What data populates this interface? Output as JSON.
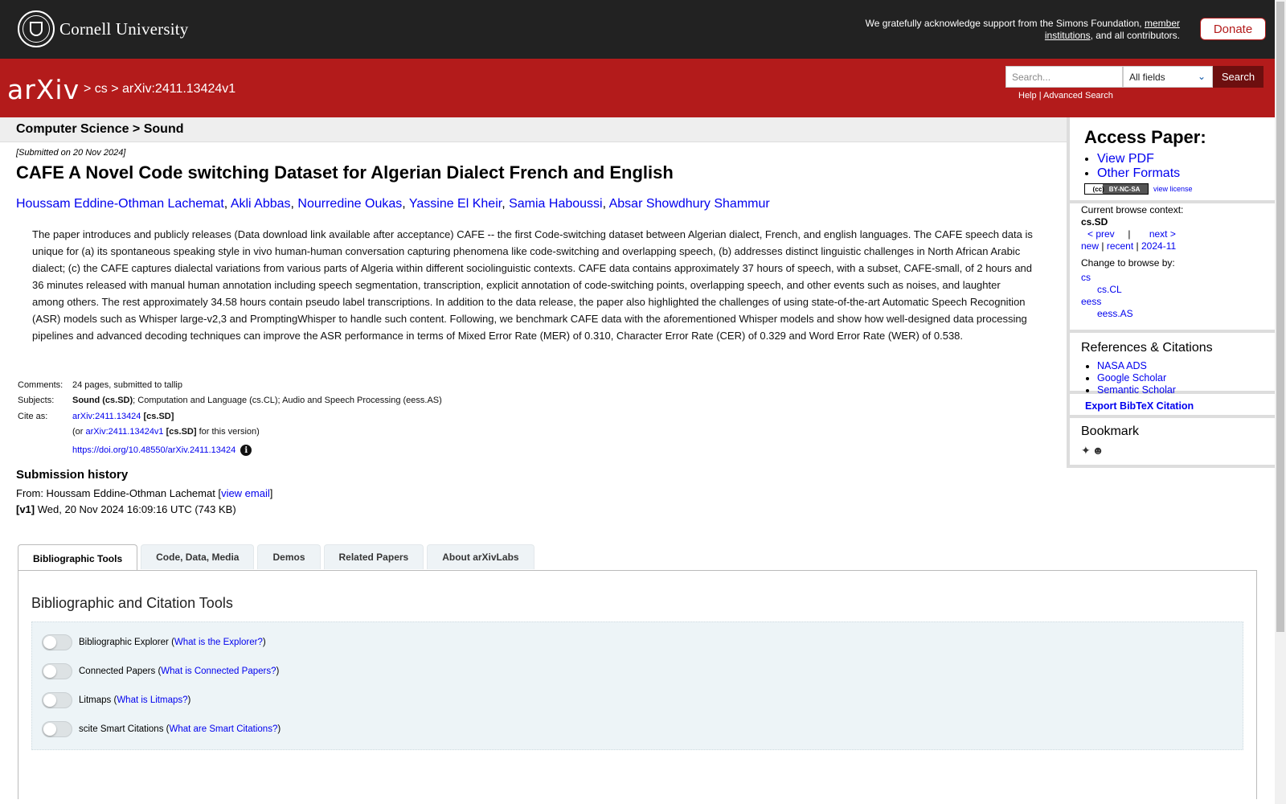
{
  "cornell": {
    "name": "Cornell University",
    "support_text": "We gratefully acknowledge support from the Simons Foundation,",
    "member_link": "member institutions",
    "support_tail": ", and all contributors.",
    "donate_label": "Donate"
  },
  "header": {
    "logo_text": "arXiv",
    "crumb_cs": "> cs >",
    "crumb_id": "arXiv:2411.13424v1",
    "search_placeholder": "Search...",
    "field_value": "All fields",
    "search_label": "Search",
    "help_label": "Help",
    "separator": "|",
    "advanced_label": "Advanced Search"
  },
  "subject_header": "Computer Science > Sound",
  "submitted": "[Submitted on 20 Nov 2024]",
  "title": "CAFE A Novel Code switching Dataset for Algerian Dialect French and English",
  "authors": [
    "Houssam Eddine-Othman Lachemat",
    "Akli Abbas",
    "Nourredine Oukas",
    "Yassine El Kheir",
    "Samia Haboussi",
    "Absar Showdhury Shammur"
  ],
  "abstract": "The paper introduces and publicly releases (Data download link available after acceptance) CAFE -- the first Code-switching dataset between Algerian dialect, French, and english languages. The CAFE speech data is unique for (a) its spontaneous speaking style in vivo human-human conversation capturing phenomena like code-switching and overlapping speech, (b) addresses distinct linguistic challenges in North African Arabic dialect; (c) the CAFE captures dialectal variations from various parts of Algeria within different sociolinguistic contexts. CAFE data contains approximately 37 hours of speech, with a subset, CAFE-small, of 2 hours and 36 minutes released with manual human annotation including speech segmentation, transcription, explicit annotation of code-switching points, overlapping speech, and other events such as noises, and laughter among others. The rest approximately 34.58 hours contain pseudo label transcriptions. In addition to the data release, the paper also highlighted the challenges of using state-of-the-art Automatic Speech Recognition (ASR) models such as Whisper large-v2,3 and PromptingWhisper to handle such content. Following, we benchmark CAFE data with the aforementioned Whisper models and show how well-designed data processing pipelines and advanced decoding techniques can improve the ASR performance in terms of Mixed Error Rate (MER) of 0.310, Character Error Rate (CER) of 0.329 and Word Error Rate (WER) of 0.538.",
  "meta": {
    "comments_label": "Comments:",
    "comments": "24 pages, submitted to tallip",
    "subjects_label": "Subjects:",
    "subjects_primary": "Sound (cs.SD)",
    "subjects_rest": "; Computation and Language (cs.CL); Audio and Speech Processing (eess.AS)",
    "cite_label": "Cite as:",
    "cite_id": "arXiv:2411.13424",
    "cite_cat": "[cs.SD]",
    "version_prefix": "(or",
    "version_id": "arXiv:2411.13424v1",
    "version_cat": "[cs.SD]",
    "version_suffix": "for this version)",
    "doi": "https://doi.org/10.48550/arXiv.2411.13424"
  },
  "history": {
    "title": "Submission history",
    "from_prefix": "From: Houssam Eddine-Othman Lachemat [",
    "view_email": "view email",
    "from_suffix": "]",
    "v1_label": "[v1]",
    "v1_text": "Wed, 20 Nov 2024 16:09:16 UTC (743 KB)"
  },
  "tabs": [
    {
      "label": "Bibliographic Tools",
      "active": true
    },
    {
      "label": "Code, Data, Media"
    },
    {
      "label": "Demos"
    },
    {
      "label": "Related Papers"
    },
    {
      "label": "About arXivLabs"
    }
  ],
  "panel": {
    "title": "Bibliographic and Citation Tools",
    "tools": [
      {
        "label": "Bibliographic Explorer",
        "link": "What is the Explorer?"
      },
      {
        "label": "Connected Papers",
        "link": "What is Connected Papers?"
      },
      {
        "label": "Litmaps",
        "link": "What is Litmaps?"
      },
      {
        "label": "scite Smart Citations",
        "link": "What are Smart Citations?"
      }
    ]
  },
  "sidebar": {
    "access_title": "Access Paper:",
    "view_pdf": "View PDF",
    "other_formats": "Other Formats",
    "license_badge": "BY-NC-SA",
    "license_cc": "(cc)",
    "view_license": "view license",
    "browse_context_label": "Current browse context:",
    "browse_context": "cs.SD",
    "prev": "< prev",
    "pipe": "|",
    "next": "next >",
    "new": "new",
    "recent": "recent",
    "month": "2024-11",
    "change_browse": "Change to browse by:",
    "cats": [
      "cs",
      "cs.CL",
      "eess",
      "eess.AS"
    ],
    "refs_title": "References & Citations",
    "refs": [
      "NASA ADS",
      "Google Scholar",
      "Semantic Scholar"
    ],
    "bibtex": "Export BibTeX Citation",
    "bookmark_title": "Bookmark"
  }
}
